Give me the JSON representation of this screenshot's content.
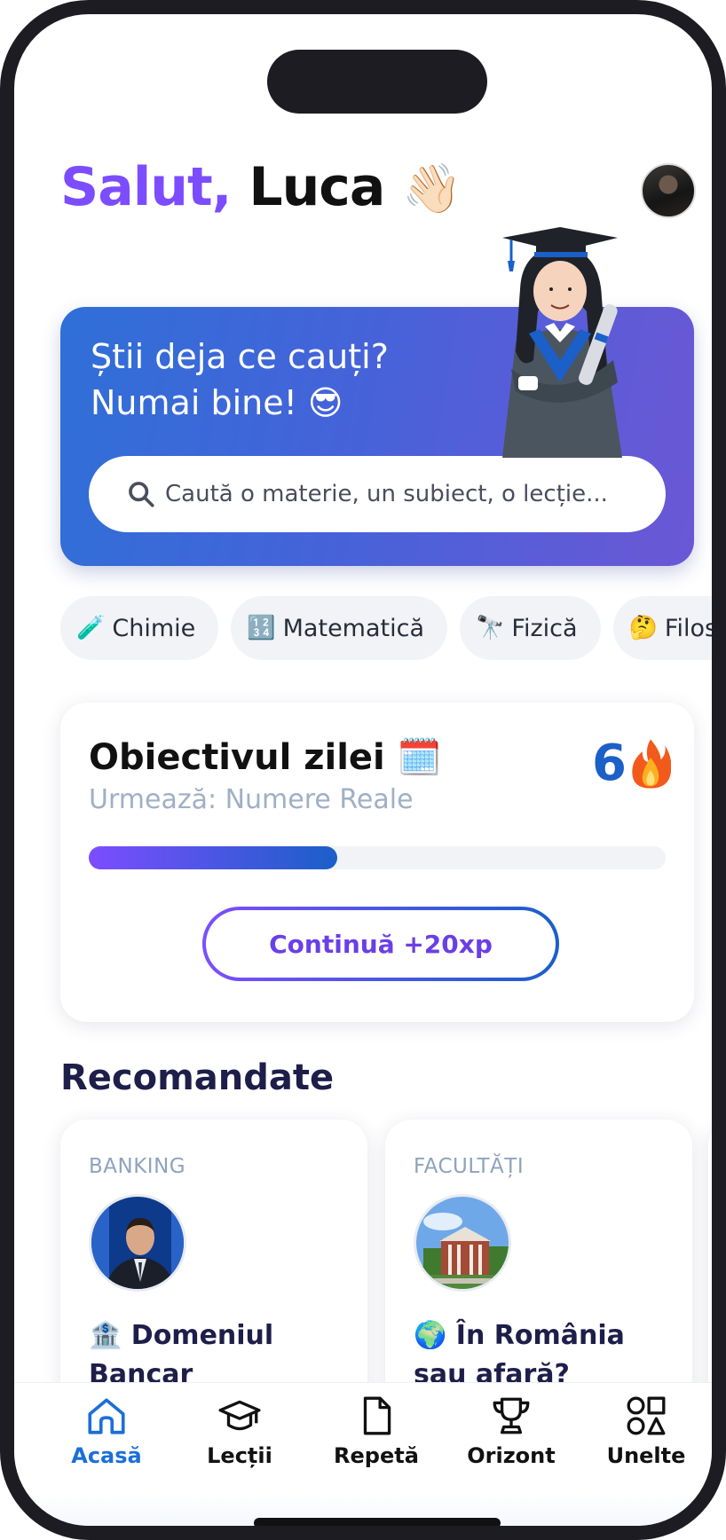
{
  "header": {
    "greeting": "Salut,",
    "user_name": "Luca",
    "wave_emoji": "👋🏻"
  },
  "hero": {
    "line1": "Știi deja ce cauți?",
    "line2": "Numai bine! 😎",
    "search_placeholder": "Caută o materie, un subiect, o lecție..."
  },
  "chips": [
    {
      "emoji": "🧪",
      "label": "Chimie"
    },
    {
      "emoji": "🔢",
      "label": "Matematică"
    },
    {
      "emoji": "🔭",
      "label": "Fizică"
    },
    {
      "emoji": "🤔",
      "label": "Filosofie"
    }
  ],
  "goal": {
    "title": "Obiectivul zilei 🗓️",
    "next": "Urmează: Numere Reale",
    "streak": "6",
    "progress_percent": 43,
    "cta": "Continuă +20xp"
  },
  "recommended": {
    "title": "Recomandate",
    "cards": [
      {
        "category": "BANKING",
        "title": "🏦 Domeniul Bancar"
      },
      {
        "category": "FACULTĂȚI",
        "title": "🌍 În România sau afară?"
      }
    ]
  },
  "nav": {
    "items": [
      {
        "label": "Acasă",
        "icon": "home-icon",
        "active": true
      },
      {
        "label": "Lecții",
        "icon": "graduation-cap-icon",
        "active": false
      },
      {
        "label": "Repetă",
        "icon": "document-icon",
        "active": false
      },
      {
        "label": "Orizont",
        "icon": "trophy-icon",
        "active": false
      },
      {
        "label": "Unelte",
        "icon": "shapes-icon",
        "active": false
      }
    ]
  },
  "colors": {
    "accent_purple": "#7c4dff",
    "accent_blue": "#1b5fc8",
    "nav_active": "#1b6fd8"
  }
}
